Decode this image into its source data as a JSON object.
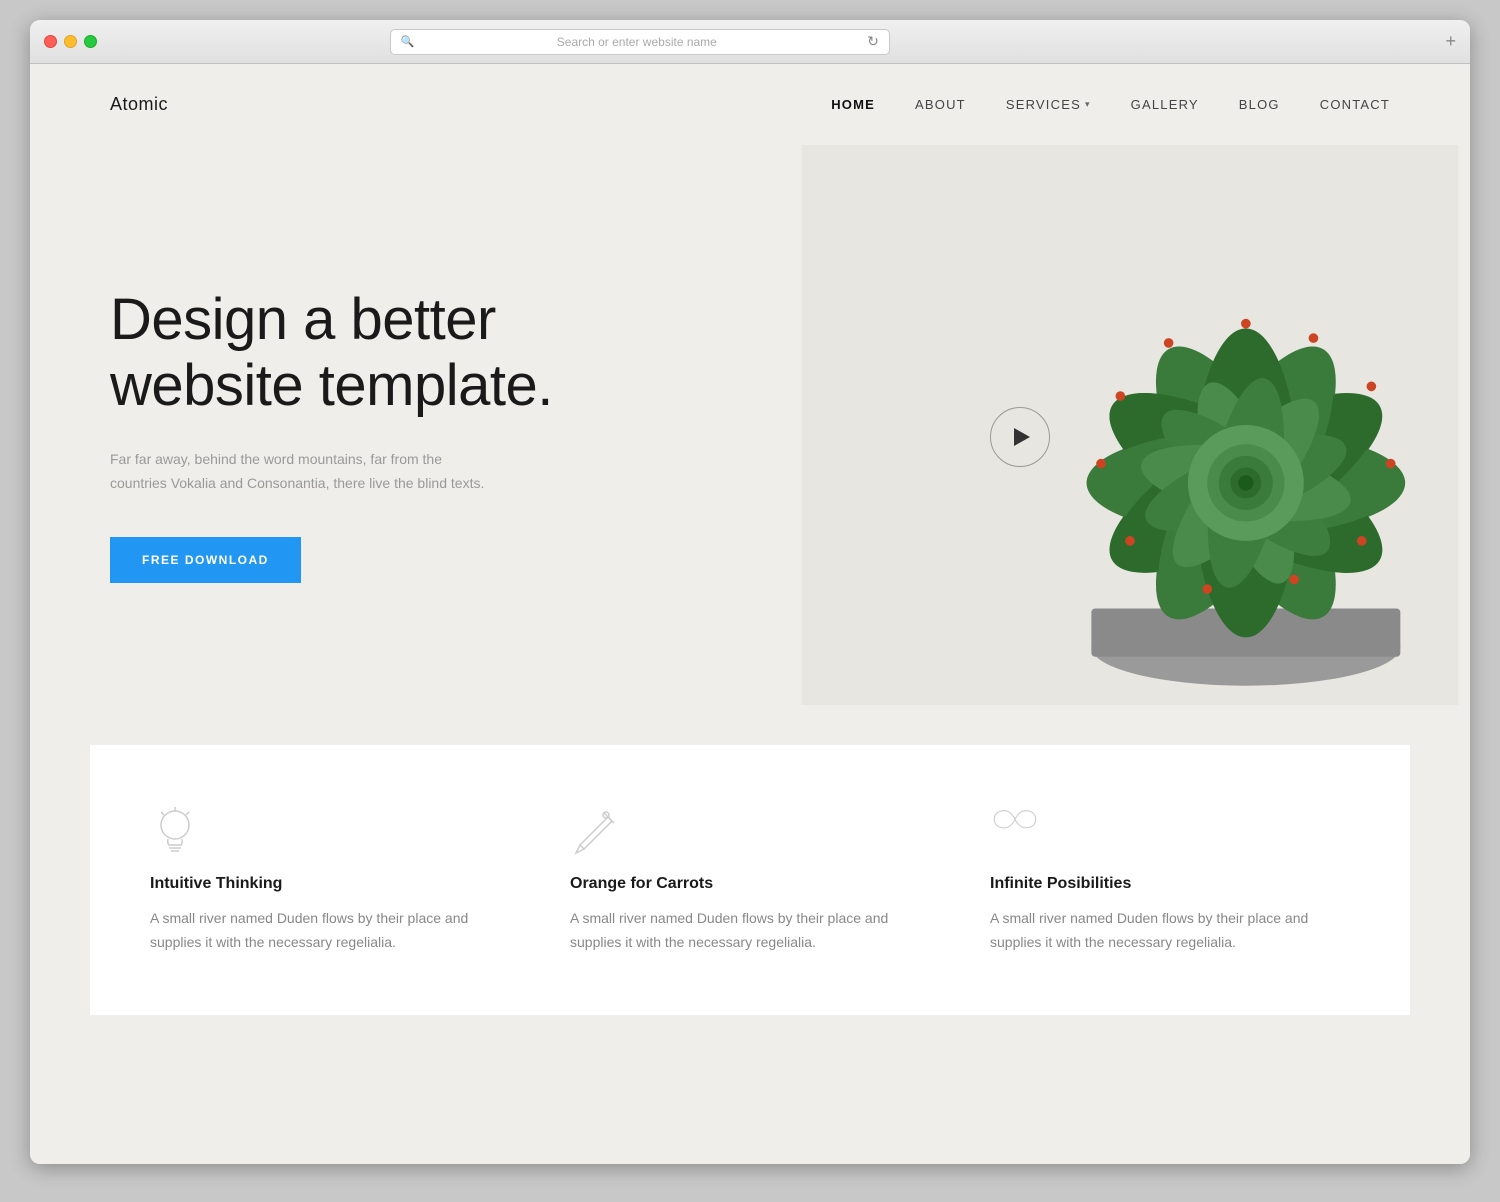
{
  "browser": {
    "addressbar_placeholder": "Search or enter website name",
    "new_tab_label": "+"
  },
  "nav": {
    "logo": "Atomic",
    "links": [
      {
        "label": "HOME",
        "active": true
      },
      {
        "label": "ABOUT",
        "active": false
      },
      {
        "label": "SERVICES",
        "active": false,
        "has_dropdown": true
      },
      {
        "label": "GALLERY",
        "active": false
      },
      {
        "label": "BLOG",
        "active": false
      },
      {
        "label": "CONTACT",
        "active": false
      }
    ]
  },
  "hero": {
    "title": "Design a better\nwebsite template.",
    "subtitle": "Far far away, behind the word mountains, far from the countries Vokalia and Consonantia, there live the blind texts.",
    "cta_label": "FREE DOWNLOAD"
  },
  "features": [
    {
      "icon": "lightbulb",
      "title": "Intuitive Thinking",
      "description": "A small river named Duden flows by their place and supplies it with the necessary regelialia."
    },
    {
      "icon": "pencil",
      "title": "Orange for Carrots",
      "description": "A small river named Duden flows by their place and supplies it with the necessary regelialia."
    },
    {
      "icon": "infinity",
      "title": "Infinite Posibilities",
      "description": "A small river named Duden flows by their place and supplies it with the necessary regelialia."
    }
  ]
}
